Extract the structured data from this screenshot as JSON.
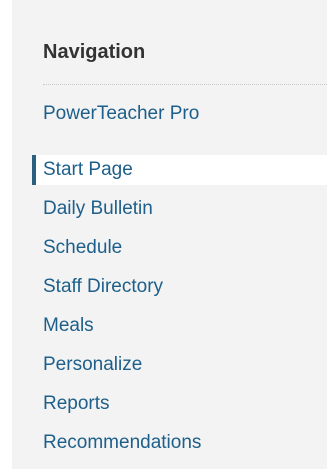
{
  "navigation": {
    "heading": "Navigation",
    "app_link": "PowerTeacher Pro",
    "items": [
      {
        "label": "Start Page",
        "selected": true
      },
      {
        "label": "Daily Bulletin",
        "selected": false
      },
      {
        "label": "Schedule",
        "selected": false
      },
      {
        "label": "Staff Directory",
        "selected": false
      },
      {
        "label": "Meals",
        "selected": false
      },
      {
        "label": "Personalize",
        "selected": false
      },
      {
        "label": "Reports",
        "selected": false
      },
      {
        "label": "Recommendations",
        "selected": false
      }
    ]
  },
  "colors": {
    "link": "#1d5f8a",
    "heading": "#333333",
    "sidebar_bg": "#f3f3f3",
    "selected_indicator": "#2b5f7f"
  }
}
